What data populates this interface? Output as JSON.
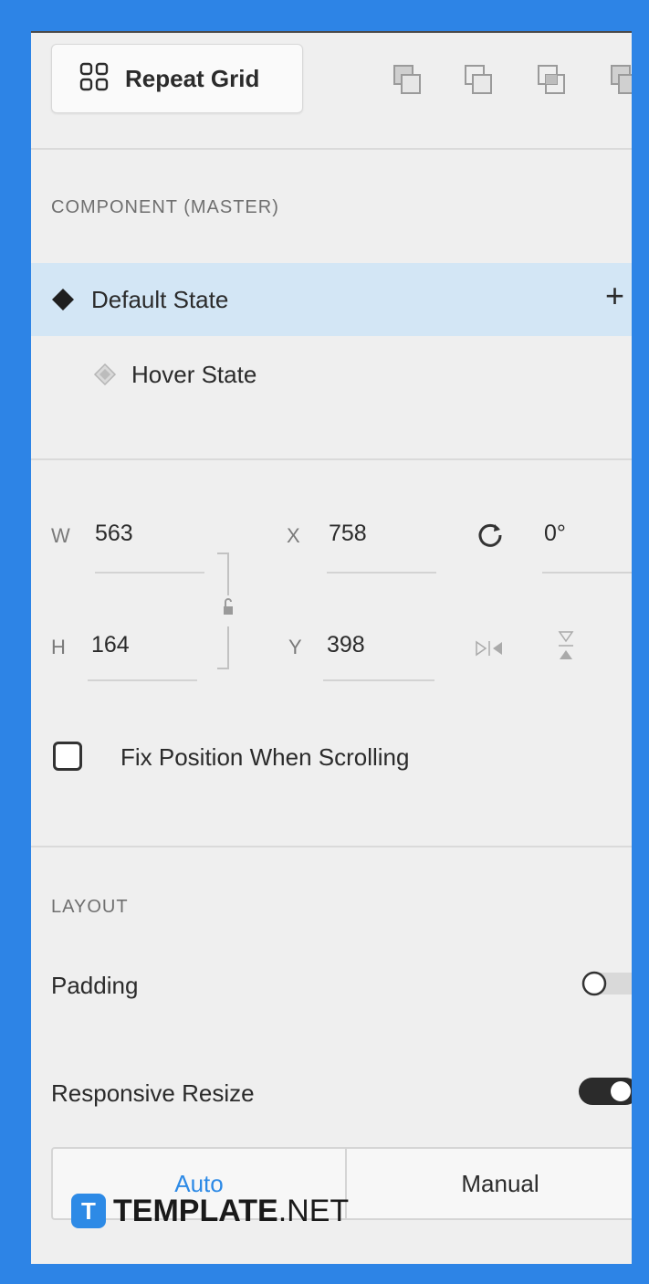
{
  "toolbar": {
    "repeat_grid_label": "Repeat Grid",
    "icons": [
      "group-icon",
      "duplicate-icon",
      "intersect-icon",
      "exclude-icon"
    ]
  },
  "component": {
    "section_title": "COMPONENT (MASTER)",
    "states": [
      {
        "label": "Default State",
        "selected": true,
        "icon": "diamond-filled-icon"
      },
      {
        "label": "Hover State",
        "selected": false,
        "icon": "diamond-outline-icon"
      }
    ],
    "add_icon": "+"
  },
  "transform": {
    "w_label": "W",
    "w_value": "563",
    "x_label": "X",
    "x_value": "758",
    "rotation_value": "0°",
    "h_label": "H",
    "h_value": "164",
    "y_label": "Y",
    "y_value": "398"
  },
  "fix_position": {
    "label": "Fix Position When Scrolling",
    "checked": false
  },
  "layout": {
    "section_title": "LAYOUT",
    "padding_label": "Padding",
    "padding_on": false,
    "responsive_label": "Responsive Resize",
    "responsive_on": true,
    "modes": [
      "Auto",
      "Manual"
    ],
    "active_mode": "Auto"
  },
  "watermark": {
    "logo_letter": "T",
    "brand_bold": "TEMPLATE",
    "brand_suffix": ".NET"
  },
  "colors": {
    "frame": "#2d84e6",
    "accent": "#2d8ae6",
    "selected_row": "#d3e6f5"
  }
}
